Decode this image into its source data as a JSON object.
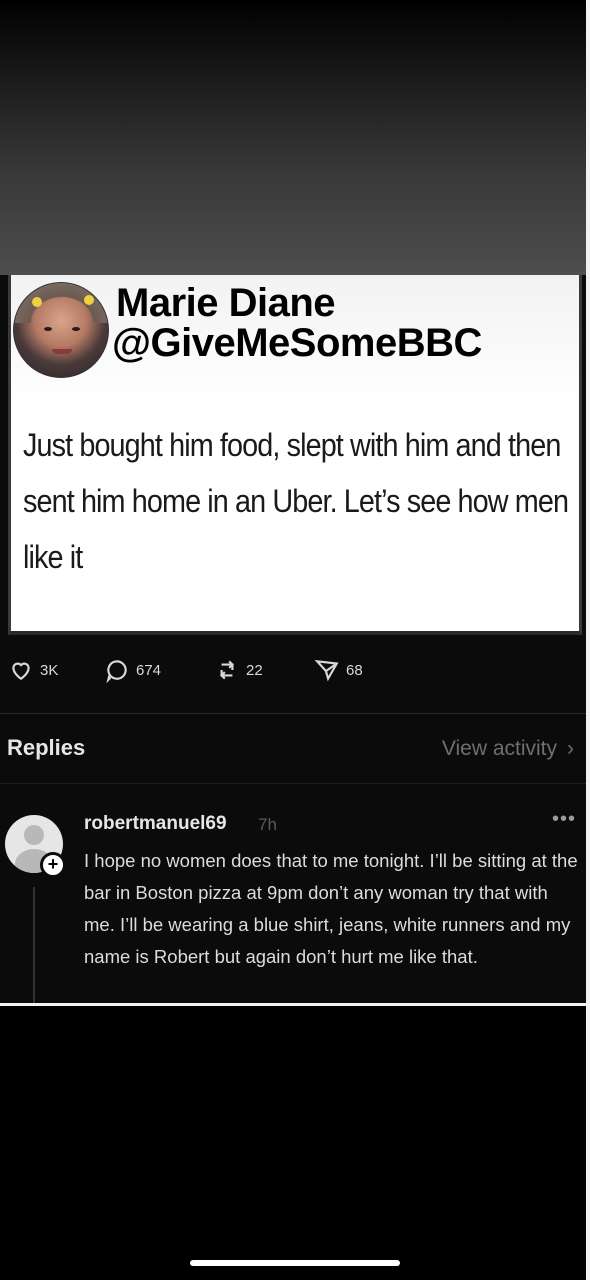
{
  "overlay": {
    "name": "Marie Diane",
    "handle": "@GiveMeSomeBBC"
  },
  "post": {
    "text": "Just bought him food, slept with him and then sent him home in an Uber. Let’s see how men like it",
    "actions": {
      "likes": "3K",
      "comments": "674",
      "reposts": "22",
      "shares": "68"
    }
  },
  "replies": {
    "label": "Replies",
    "view_activity": "View activity",
    "items": [
      {
        "username": "robertmanuel69",
        "time": "7h",
        "more": "•••",
        "text": "I hope no women does that to me tonight. I’ll be sitting at the bar in Boston pizza at 9pm don’t any woman try that with me. I’ll be wearing a blue shirt, jeans, white runners and my name is Robert but again don’t hurt me like that."
      }
    ]
  },
  "colors": {
    "background": "#000000",
    "card": "#ffffff",
    "text_light": "#dcdcdc",
    "muted": "#6f6f6f"
  }
}
